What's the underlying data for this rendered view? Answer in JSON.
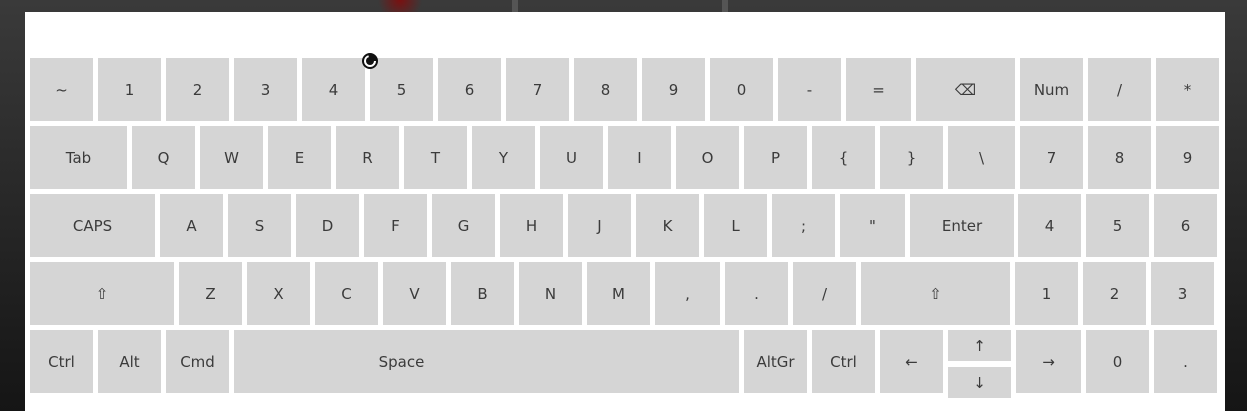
{
  "keyboard": {
    "row1": [
      "~",
      "1",
      "2",
      "3",
      "4",
      "5",
      "6",
      "7",
      "8",
      "9",
      "0",
      "-",
      "=",
      "⌫",
      "Num",
      "/",
      "*"
    ],
    "row2": [
      "Tab",
      "Q",
      "W",
      "E",
      "R",
      "T",
      "Y",
      "U",
      "I",
      "O",
      "P",
      "{",
      "}",
      "\\",
      "7",
      "8",
      "9"
    ],
    "row3": [
      "CAPS",
      "A",
      "S",
      "D",
      "F",
      "G",
      "H",
      "J",
      "K",
      "L",
      ";",
      "\"",
      "Enter",
      "4",
      "5",
      "6"
    ],
    "row4": [
      "⇧",
      "Z",
      "X",
      "C",
      "V",
      "B",
      "N",
      "M",
      ",",
      ".",
      "/",
      "⇧",
      "1",
      "2",
      "3"
    ],
    "row5": [
      "Ctrl",
      "Alt",
      "Cmd",
      "Space",
      "AltGr",
      "Ctrl",
      "←",
      "↑",
      "↓",
      "→",
      "0",
      "."
    ]
  },
  "colors": {
    "key": "#d5d5d5",
    "key_text": "#3b3b3b",
    "panel": "#ffffff"
  }
}
